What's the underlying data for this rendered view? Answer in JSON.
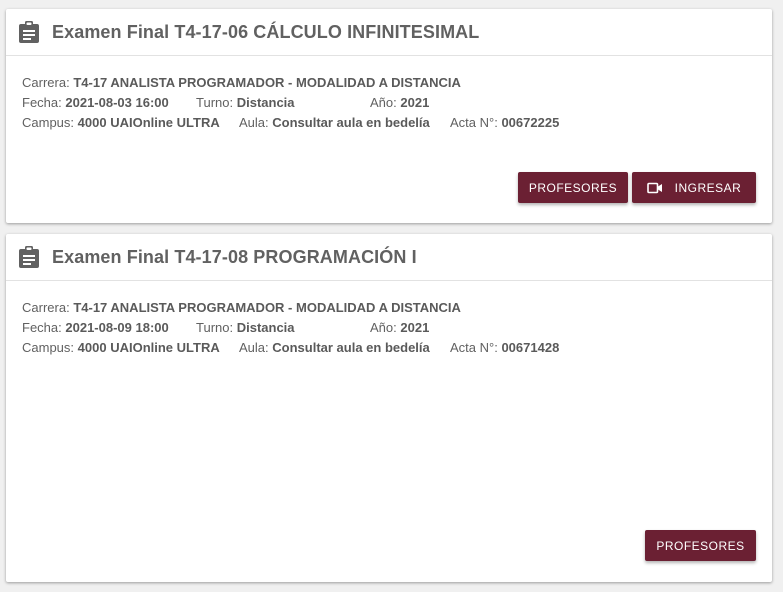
{
  "colors": {
    "button_bg": "#6b2033",
    "button_text": "#ffffff",
    "text": "#616161"
  },
  "labels": {
    "carrera": "Carrera:",
    "fecha": "Fecha:",
    "turno": "Turno:",
    "anio": "Año:",
    "campus": "Campus:",
    "aula": "Aula:",
    "acta": "Acta N°:"
  },
  "exams": [
    {
      "title": "Examen Final T4-17-06 CÁLCULO INFINITESIMAL",
      "header_icon": "clipboard-icon",
      "carrera": "T4-17 ANALISTA PROGRAMADOR - MODALIDAD A DISTANCIA",
      "fecha": "2021-08-03 16:00",
      "turno": "Distancia",
      "anio": "2021",
      "campus": "4000 UAIOnline ULTRA",
      "aula": "Consultar aula en bedelía",
      "acta": "00672225",
      "buttons": {
        "profesores": "PROFESORES",
        "ingresar": "INGRESAR",
        "ingresar_icon": "video-camera-icon"
      }
    },
    {
      "title": "Examen Final T4-17-08 PROGRAMACIÓN I",
      "header_icon": "clipboard-icon",
      "carrera": "T4-17 ANALISTA PROGRAMADOR - MODALIDAD A DISTANCIA",
      "fecha": "2021-08-09 18:00",
      "turno": "Distancia",
      "anio": "2021",
      "campus": "4000 UAIOnline ULTRA",
      "aula": "Consultar aula en bedelía",
      "acta": "00671428",
      "buttons": {
        "profesores": "PROFESORES"
      }
    }
  ]
}
